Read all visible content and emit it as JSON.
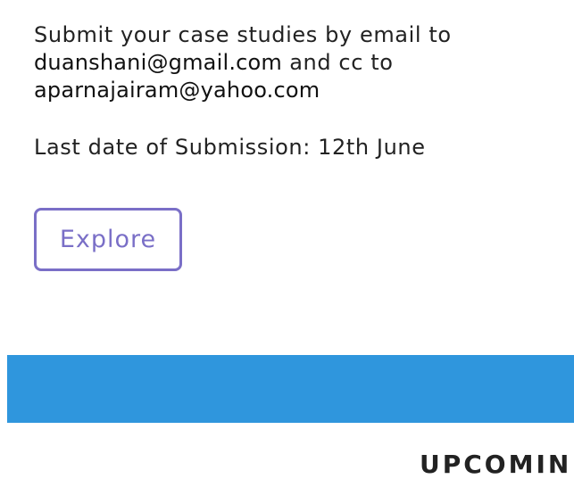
{
  "submission": {
    "line1": "Submit your case studies by email to",
    "email_primary": "duanshani@gmail.com",
    "cc_text": " and cc to",
    "email_cc": "aparnajairam@yahoo.com"
  },
  "deadline": {
    "text": "Last date of Submission: 12th June"
  },
  "explore_button": {
    "label": "Explore"
  },
  "upcoming_heading": {
    "text": "UPCOMIN"
  },
  "colors": {
    "accent_button": "#7a6fc7",
    "band_blue": "#2f96dd"
  }
}
